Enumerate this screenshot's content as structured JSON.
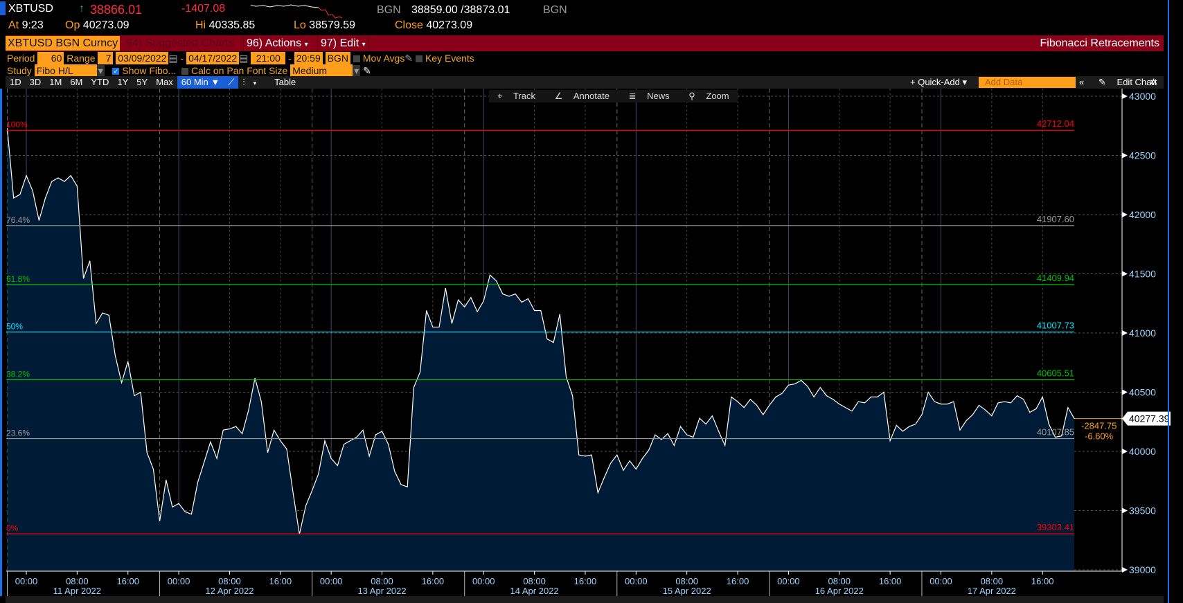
{
  "header": {
    "ticker": "XBTUSD",
    "last": "38866.01",
    "change": "-1407.08",
    "source": "BGN",
    "bid_ask": "38859.00 /38873.01",
    "source2": "BGN",
    "at_label": "At",
    "at": "9:23",
    "op_label": "Op",
    "op": "40273.09",
    "hi_label": "Hi",
    "hi": "40335.85",
    "lo_label": "Lo",
    "lo": "38579.59",
    "close_label": "Close",
    "close": "40273.09"
  },
  "menubar": {
    "security": "XBTUSD BGN Curncy",
    "suggested": "94) Suggested Charts",
    "actions": "96) Actions",
    "edit": "97) Edit",
    "title": "Fibonacci Retracements"
  },
  "settings": {
    "period_label": "Period",
    "period": "60",
    "range_label": "Range",
    "range": "7",
    "start_date": "03/09/2022",
    "end_date": "04/17/2022",
    "start_time": "21:00",
    "end_time": "20:59",
    "source": "BGN",
    "mov_avgs": "Mov Avgs",
    "key_events": "Key Events",
    "study_label": "Study",
    "study": "Fibo H/L",
    "show_fibo": "Show Fibo...",
    "show_fibo_checked": true,
    "calc_on_pan": "Calc on Pan",
    "calc_on_pan_checked": false,
    "font_size_label": "Font Size",
    "font_size": "Medium"
  },
  "toolbar": {
    "ranges": [
      "1D",
      "3D",
      "1M",
      "6M",
      "YTD",
      "1Y",
      "5Y",
      "Max"
    ],
    "interval": "60 Min ▼",
    "table": "Table",
    "quick_add": "+ Quick-Add ▾",
    "add_data_placeholder": "Add Data",
    "edit_chart": "Edit Chart"
  },
  "chart_controls": {
    "track": "Track",
    "annotate": "Annotate",
    "news": "News",
    "zoom": "Zoom"
  },
  "colors": {
    "accent": "#ff9e1b",
    "menubar": "#8a0018",
    "line": "#ffffff",
    "area": "#001b36",
    "red": "#ff0000",
    "green": "#00c000",
    "cyan": "#00e5ff",
    "gray": "#9a9a9a"
  },
  "chart_data": {
    "type": "area",
    "x_start": "2022-04-10 21:00",
    "interval": "60 Min",
    "ylim": [
      39000,
      43000
    ],
    "yticks": [
      "39000",
      "39500",
      "40000",
      "40500",
      "41000",
      "41500",
      "42000",
      "42500",
      "43000"
    ],
    "xticks": [
      "00:00",
      "08:00",
      "16:00"
    ],
    "dates": [
      "11 Apr 2022",
      "12 Apr 2022",
      "13 Apr 2022",
      "14 Apr 2022",
      "15 Apr 2022",
      "16 Apr 2022",
      "17 Apr 2022"
    ],
    "last_value": "40277.39",
    "net_change": "-2847.75",
    "pct_change": "-6.60%",
    "fib_levels": [
      {
        "pct": "100%",
        "value": "42712.04",
        "color": "#ff0000"
      },
      {
        "pct": "76.4%",
        "value": "41907.60",
        "color": "#9a9a9a"
      },
      {
        "pct": "61.8%",
        "value": "41409.94",
        "color": "#00c000"
      },
      {
        "pct": "50%",
        "value": "41007.73",
        "color": "#00e5ff"
      },
      {
        "pct": "38.2%",
        "value": "40605.51",
        "color": "#00c000"
      },
      {
        "pct": "23.6%",
        "value": "40107.85",
        "color": "#9a9a9a"
      },
      {
        "pct": "0%",
        "value": "39303.41",
        "color": "#ff0000"
      }
    ],
    "values": [
      42730,
      42140,
      42170,
      42330,
      42200,
      41950,
      42140,
      42280,
      42310,
      42280,
      42330,
      42240,
      41460,
      41610,
      41080,
      41170,
      41150,
      40810,
      40580,
      40760,
      40470,
      40500,
      39990,
      39850,
      39410,
      39760,
      39530,
      39560,
      39490,
      39470,
      39740,
      39910,
      40080,
      39940,
      40180,
      40190,
      40210,
      40150,
      40350,
      40620,
      40420,
      39990,
      40180,
      40090,
      40020,
      39650,
      39300,
      39540,
      39670,
      39810,
      40090,
      39940,
      39880,
      40060,
      40090,
      40120,
      40180,
      39960,
      40140,
      40170,
      40060,
      39830,
      39720,
      39700,
      40540,
      40670,
      41190,
      41050,
      41050,
      41380,
      41080,
      41280,
      41220,
      41300,
      41180,
      41270,
      41490,
      41440,
      41330,
      41310,
      41330,
      41260,
      41290,
      41190,
      41190,
      40950,
      40920,
      41160,
      40630,
      40470,
      39970,
      39960,
      39970,
      39650,
      39780,
      39900,
      39970,
      39840,
      39920,
      39850,
      39940,
      40010,
      40140,
      40100,
      40150,
      40050,
      40210,
      40140,
      40120,
      40280,
      40230,
      40300,
      40170,
      40050,
      40460,
      40420,
      40370,
      40440,
      40390,
      40310,
      40390,
      40460,
      40490,
      40560,
      40570,
      40600,
      40550,
      40460,
      40540,
      40470,
      40440,
      40400,
      40370,
      40340,
      40420,
      40410,
      40460,
      40460,
      40500,
      40090,
      40220,
      40170,
      40210,
      40230,
      40310,
      40500,
      40420,
      40400,
      40400,
      40420,
      40180,
      40260,
      40310,
      40390,
      40350,
      40300,
      40410,
      40420,
      40410,
      40470,
      40440,
      40330,
      40360,
      40460,
      40230,
      40120,
      40130,
      40370,
      40277.39
    ]
  }
}
